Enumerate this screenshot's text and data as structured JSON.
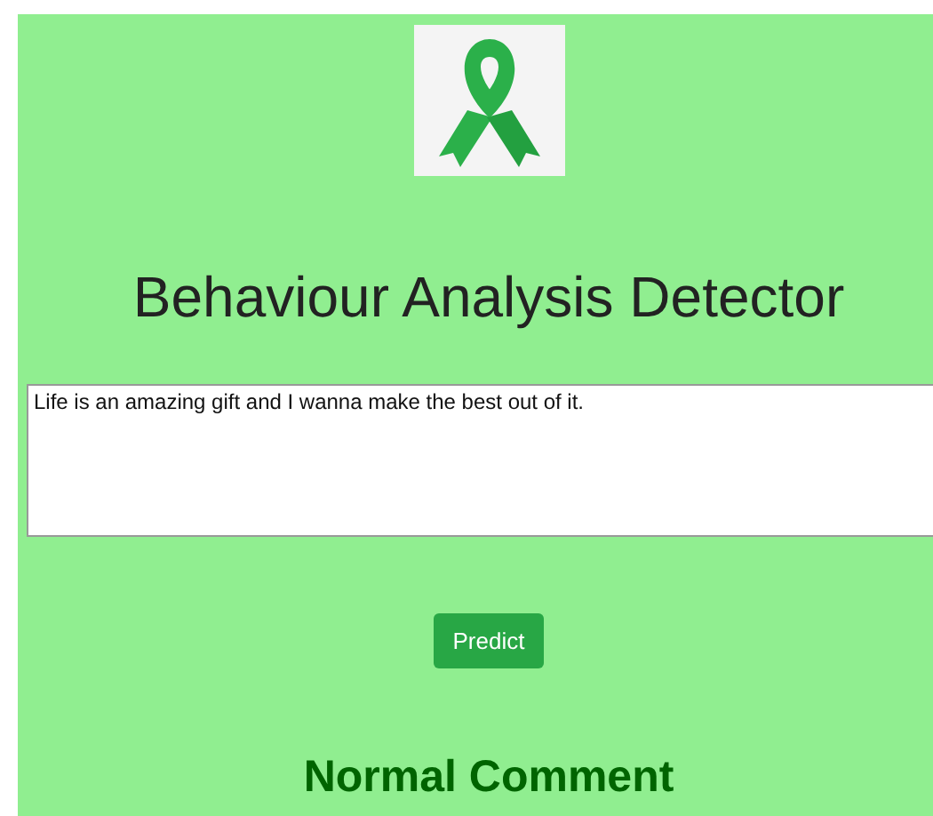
{
  "header": {
    "title": "Behaviour Analysis Detector"
  },
  "form": {
    "comment": "Life is an amazing gift and I wanna make the best out of it.",
    "button": "Predict"
  },
  "result": {
    "label": "Normal Comment"
  }
}
